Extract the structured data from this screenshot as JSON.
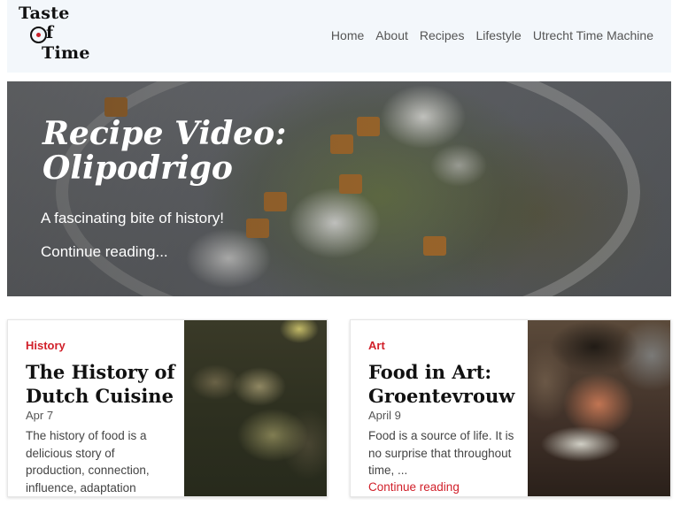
{
  "site": {
    "logo": {
      "line1": "Taste",
      "line2_mid": "f",
      "line3": "Time"
    }
  },
  "nav": {
    "items": [
      {
        "label": "Home"
      },
      {
        "label": "About"
      },
      {
        "label": "Recipes"
      },
      {
        "label": "Lifestyle"
      },
      {
        "label": "Utrecht Time Machine"
      }
    ]
  },
  "hero": {
    "title": "Recipe Video: Olipodrigo",
    "subtitle": "A fascinating bite of history!",
    "link": "Continue reading..."
  },
  "cards": [
    {
      "category": "History",
      "title": "The History of Dutch Cuisine",
      "date": "Apr 7",
      "excerpt": "The history of food is a delicious story of production, connection, influence, adaptation",
      "more": ""
    },
    {
      "category": "Art",
      "title": "Food in Art: Groentevrouw",
      "date": "April 9",
      "excerpt": "Food is a source of life. It is no surprise that throughout time, ...",
      "more": "Continue reading"
    }
  ],
  "colors": {
    "accent": "#d1202a",
    "header_bg": "#f3f7fb"
  }
}
